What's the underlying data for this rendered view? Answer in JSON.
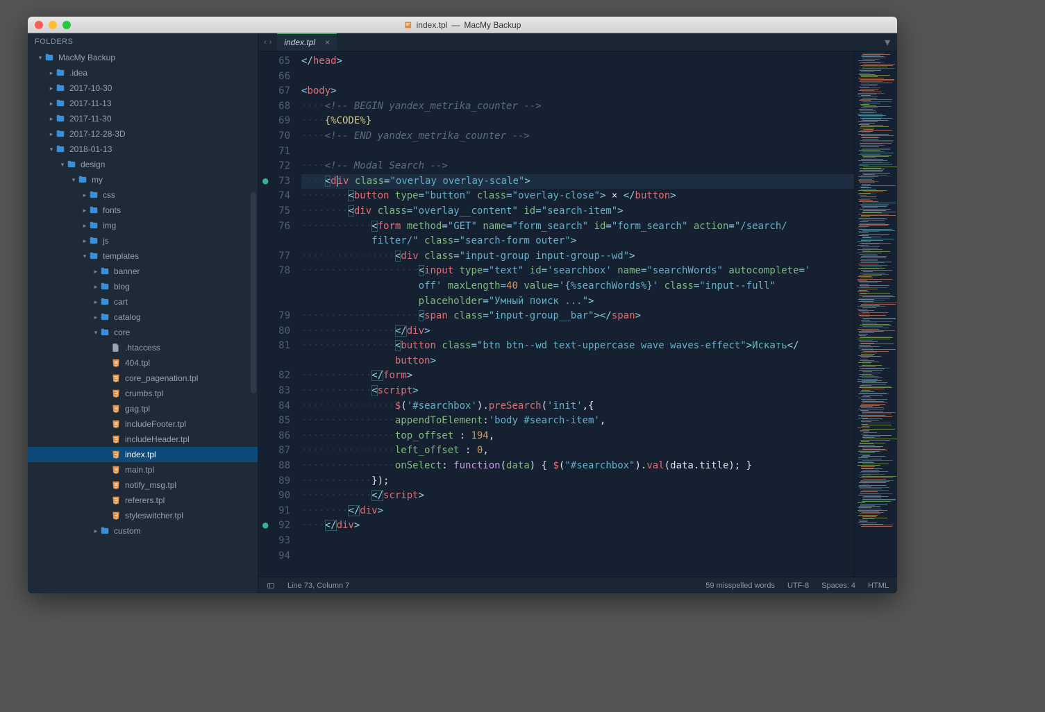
{
  "window": {
    "title_file": "index.tpl",
    "title_project": "MacMy Backup"
  },
  "sidebar": {
    "header": "FOLDERS",
    "tree": [
      {
        "depth": 0,
        "icon": "folder",
        "arrow": "down",
        "label": "MacMy Backup"
      },
      {
        "depth": 1,
        "icon": "folder",
        "arrow": "right",
        "label": ".idea"
      },
      {
        "depth": 1,
        "icon": "folder",
        "arrow": "right",
        "label": "2017-10-30"
      },
      {
        "depth": 1,
        "icon": "folder",
        "arrow": "right",
        "label": "2017-11-13"
      },
      {
        "depth": 1,
        "icon": "folder",
        "arrow": "right",
        "label": "2017-11-30"
      },
      {
        "depth": 1,
        "icon": "folder",
        "arrow": "right",
        "label": "2017-12-28-3D"
      },
      {
        "depth": 1,
        "icon": "folder",
        "arrow": "down",
        "label": "2018-01-13"
      },
      {
        "depth": 2,
        "icon": "folder",
        "arrow": "down",
        "label": "design"
      },
      {
        "depth": 3,
        "icon": "folder",
        "arrow": "down",
        "label": "my"
      },
      {
        "depth": 4,
        "icon": "folder",
        "arrow": "right",
        "label": "css"
      },
      {
        "depth": 4,
        "icon": "folder",
        "arrow": "right",
        "label": "fonts"
      },
      {
        "depth": 4,
        "icon": "folder",
        "arrow": "right",
        "label": "img"
      },
      {
        "depth": 4,
        "icon": "folder",
        "arrow": "right",
        "label": "js"
      },
      {
        "depth": 4,
        "icon": "folder",
        "arrow": "down",
        "label": "templates"
      },
      {
        "depth": 5,
        "icon": "folder",
        "arrow": "right",
        "label": "banner"
      },
      {
        "depth": 5,
        "icon": "folder",
        "arrow": "right",
        "label": "blog"
      },
      {
        "depth": 5,
        "icon": "folder",
        "arrow": "right",
        "label": "cart"
      },
      {
        "depth": 5,
        "icon": "folder",
        "arrow": "right",
        "label": "catalog"
      },
      {
        "depth": 5,
        "icon": "folder",
        "arrow": "down",
        "label": "core"
      },
      {
        "depth": 6,
        "icon": "file",
        "arrow": "",
        "label": ".htaccess"
      },
      {
        "depth": 6,
        "icon": "html",
        "arrow": "",
        "label": "404.tpl"
      },
      {
        "depth": 6,
        "icon": "html",
        "arrow": "",
        "label": "core_pagenation.tpl"
      },
      {
        "depth": 6,
        "icon": "html",
        "arrow": "",
        "label": "crumbs.tpl"
      },
      {
        "depth": 6,
        "icon": "html",
        "arrow": "",
        "label": "gag.tpl"
      },
      {
        "depth": 6,
        "icon": "html",
        "arrow": "",
        "label": "includeFooter.tpl"
      },
      {
        "depth": 6,
        "icon": "html",
        "arrow": "",
        "label": "includeHeader.tpl"
      },
      {
        "depth": 6,
        "icon": "html",
        "arrow": "",
        "label": "index.tpl",
        "selected": true
      },
      {
        "depth": 6,
        "icon": "html",
        "arrow": "",
        "label": "main.tpl"
      },
      {
        "depth": 6,
        "icon": "html",
        "arrow": "",
        "label": "notify_msg.tpl"
      },
      {
        "depth": 6,
        "icon": "html",
        "arrow": "",
        "label": "referers.tpl"
      },
      {
        "depth": 6,
        "icon": "html",
        "arrow": "",
        "label": "styleswitcher.tpl"
      },
      {
        "depth": 5,
        "icon": "folder",
        "arrow": "right",
        "label": "custom"
      }
    ]
  },
  "tabs": {
    "nav_back": "‹",
    "nav_fwd": "›",
    "active": {
      "label": "index.tpl",
      "close": "×"
    },
    "menu": "▾"
  },
  "gutter": {
    "start": 65,
    "end": 94,
    "marks": [
      73,
      92
    ],
    "wraps": {
      "76": 1,
      "78": 2,
      "81": 1
    },
    "highlight": 73
  },
  "code_text": {
    "search_btn": "Искать",
    "placeholder": "Умный поиск ...",
    "close_x": "×"
  },
  "statusbar": {
    "position": "Line 73, Column 7",
    "spell": "59 misspelled words",
    "encoding": "UTF-8",
    "spaces": "Spaces: 4",
    "syntax": "HTML"
  }
}
